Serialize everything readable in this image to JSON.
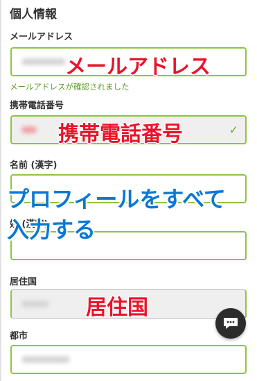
{
  "section_title": "個人情報",
  "fields": {
    "email": {
      "label": "メールアドレス",
      "overlay": "メールアドレス",
      "hint": "メールアドレスが確認されました"
    },
    "phone": {
      "label": "携帯電話番号",
      "overlay": "携帯電話番号",
      "verified_icon": "check-icon"
    },
    "name_kanji": {
      "label": "名前 (漢字)"
    },
    "surname_kanji": {
      "label": "姓 (漢字)"
    },
    "country": {
      "label": "居住国",
      "overlay": "居住国"
    },
    "city": {
      "label": "都市"
    }
  },
  "annotation": {
    "line1": "プロフィールをすべて",
    "line2": "入力する"
  },
  "chat_button": {
    "icon": "chat-bubble-icon"
  },
  "colors": {
    "accent_green": "#8cc63f",
    "overlay_red": "#e8142c",
    "overlay_blue": "#0a78d2"
  }
}
